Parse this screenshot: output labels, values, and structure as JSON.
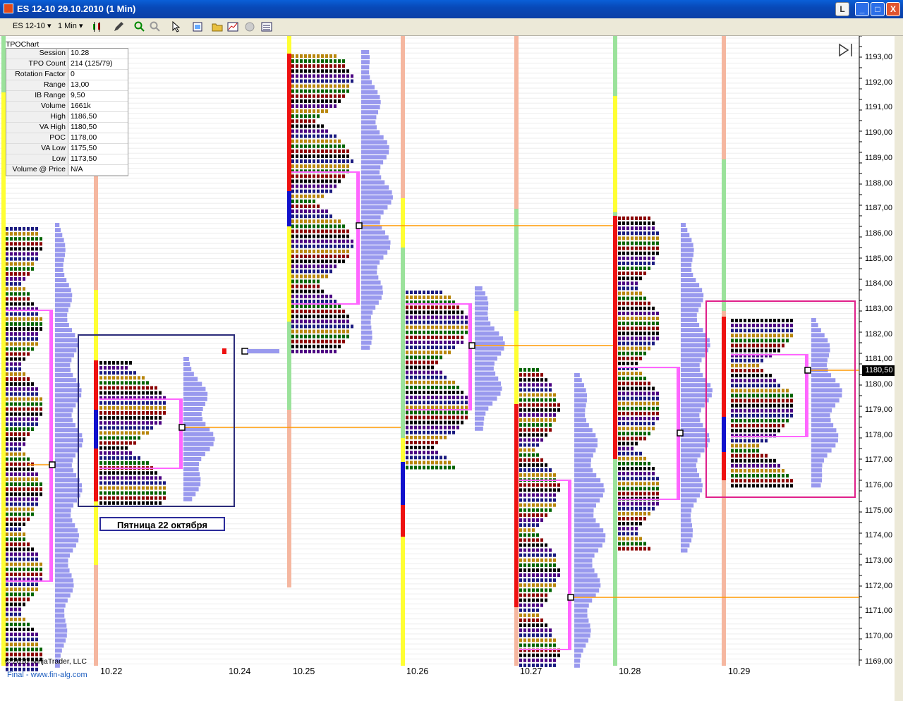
{
  "window": {
    "title": "ES 12-10  29.10.2010 (1 Min)",
    "buttons": [
      "L",
      "_",
      "□",
      "X"
    ]
  },
  "toolbar": {
    "instrument": "ES 12-10",
    "interval": "1 Min",
    "dropdown_glyph": "▾"
  },
  "chart": {
    "indicator_label": "TPOChart",
    "stats": [
      {
        "key": "Session",
        "value": "10.28"
      },
      {
        "key": "TPO Count",
        "value": "214 (125/79)"
      },
      {
        "key": "Rotation Factor",
        "value": "0"
      },
      {
        "key": "Range",
        "value": "13,00"
      },
      {
        "key": "IB Range",
        "value": "9,50"
      },
      {
        "key": "Volume",
        "value": "1661k"
      },
      {
        "key": "High",
        "value": "1186,50"
      },
      {
        "key": "VA High",
        "value": "1180,50"
      },
      {
        "key": "POC",
        "value": "1178,00"
      },
      {
        "key": "VA Low",
        "value": "1175,50"
      },
      {
        "key": "Low",
        "value": "1173,50"
      },
      {
        "key": "Volume @ Price",
        "value": "N/A"
      }
    ],
    "price_labels": [
      "1193,00",
      "1192,00",
      "1191,00",
      "1190,00",
      "1189,00",
      "1188,00",
      "1187,00",
      "1186,00",
      "1185,00",
      "1184,00",
      "1183,00",
      "1182,00",
      "1181,00",
      "1180,00",
      "1179,00",
      "1178,00",
      "1177,00",
      "1176,00",
      "1175,00",
      "1174,00",
      "1173,00",
      "1172,00",
      "1171,00",
      "1170,00",
      "1169,00"
    ],
    "current_price": "1180,50",
    "dates": [
      "10.22",
      "10.24",
      "10.25",
      "10.26",
      "10.27",
      "10.28",
      "10.29"
    ],
    "caption": "Пятница 22  октября",
    "copyright": "© 2010 NinjaTrader, LLC",
    "footer": "Final - www.fin-alg.com",
    "colors": {
      "value_area": "#ff66ff",
      "poc_line": "#ff9900",
      "profile_bar": "#9999ee",
      "box_navy": "#2b2b7a",
      "box_magenta": "#e0208a"
    }
  }
}
